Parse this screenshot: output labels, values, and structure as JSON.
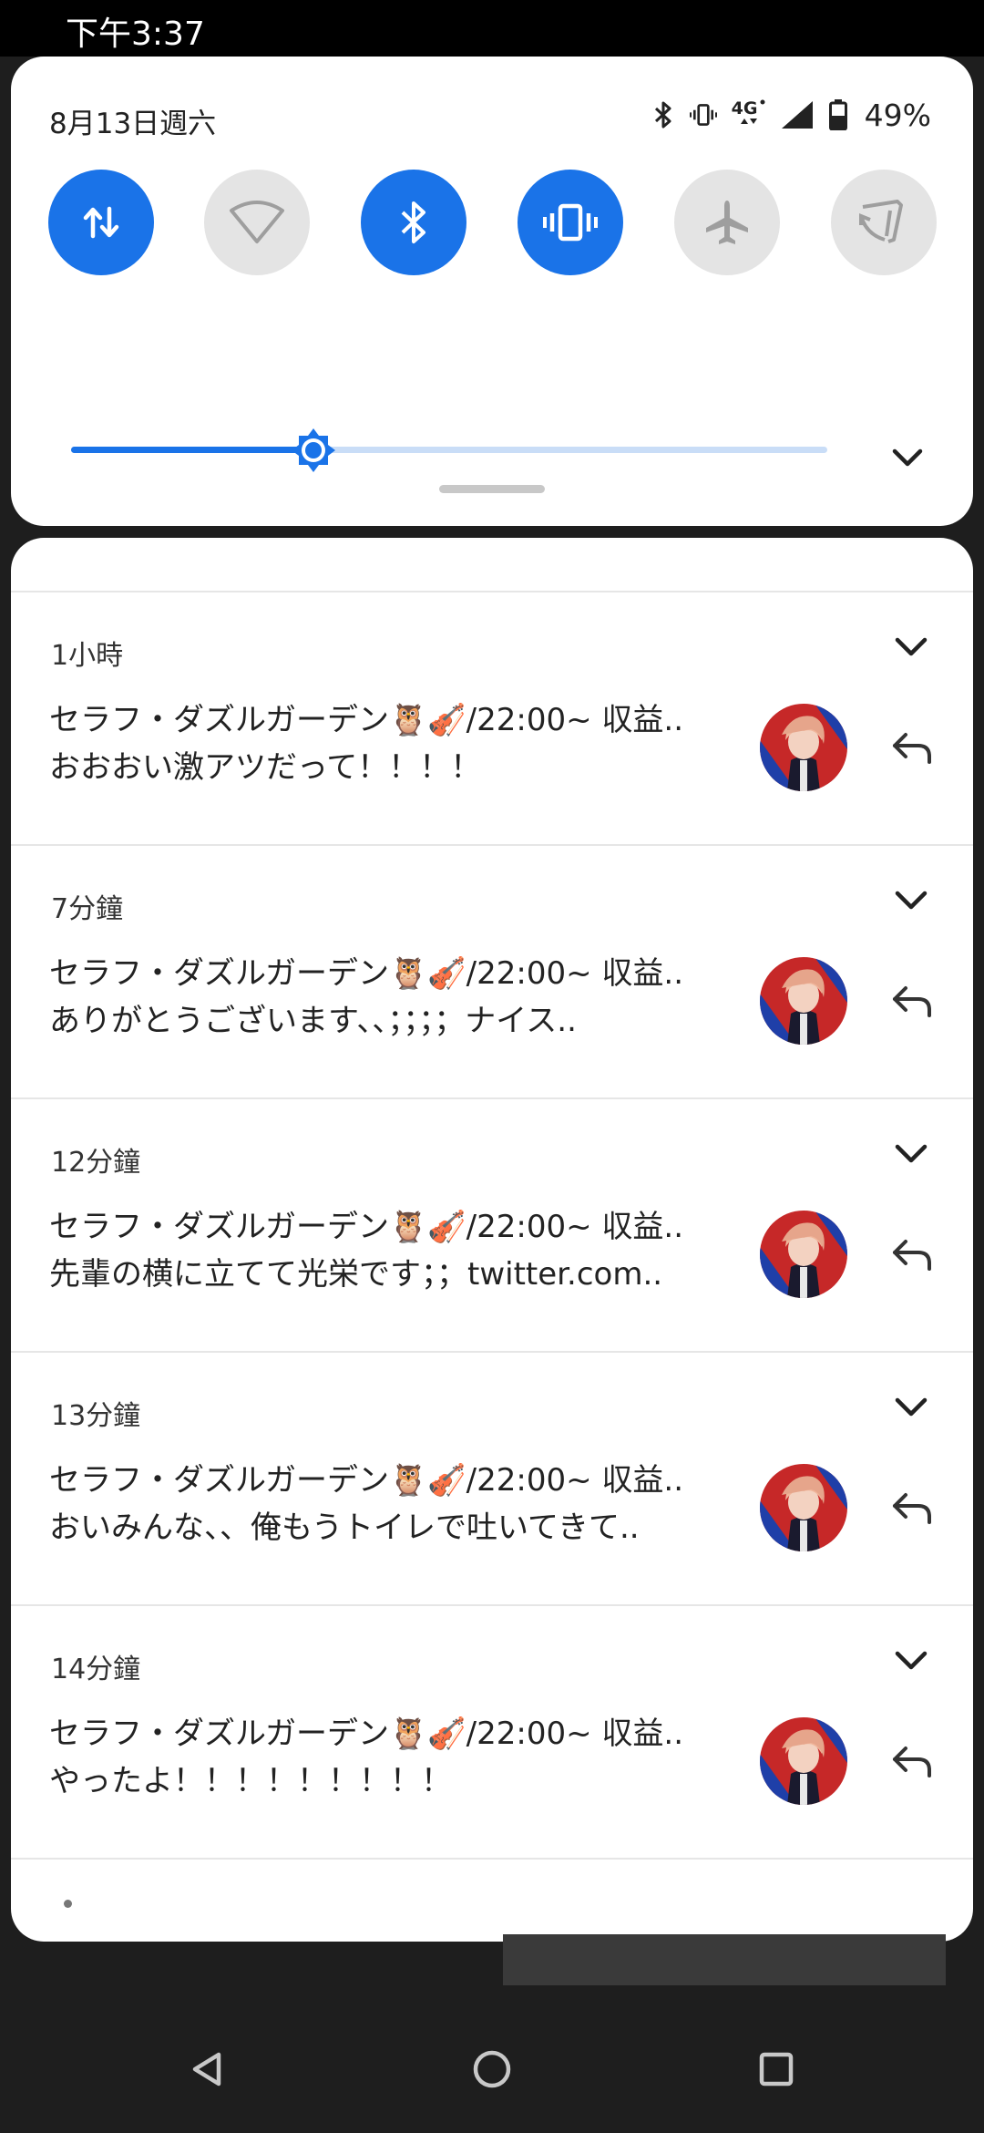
{
  "status_bar": {
    "time": "下午3:37"
  },
  "quick_settings": {
    "date": "8月13日週六",
    "battery_percent": "49%",
    "network_label": "4G",
    "tiles": [
      {
        "name": "mobile-data",
        "on": true
      },
      {
        "name": "wifi",
        "on": false
      },
      {
        "name": "bluetooth",
        "on": true
      },
      {
        "name": "vibrate",
        "on": true
      },
      {
        "name": "airplane-mode",
        "on": false
      },
      {
        "name": "auto-rotate",
        "on": false
      }
    ],
    "brightness_level": 0.32
  },
  "notifications": [
    {
      "time": "1小時",
      "title": "セラフ・ダズルガーデン🦉🎻/22:00~ 収益..",
      "body": "おおおい激アツだって！！！！"
    },
    {
      "time": "7分鐘",
      "title": "セラフ・ダズルガーデン🦉🎻/22:00~ 収益..",
      "body": "ありがとうございます、、；；；；ナイス.."
    },
    {
      "time": "12分鐘",
      "title": "セラフ・ダズルガーデン🦉🎻/22:00~ 収益..",
      "body": "先輩の横に立てて光栄です；；twitter.com.."
    },
    {
      "time": "13分鐘",
      "title": "セラフ・ダズルガーデン🦉🎻/22:00~ 収益..",
      "body": "おいみんな、、俺もうトイレで吐いてきて.."
    },
    {
      "time": "14分鐘",
      "title": "セラフ・ダズルガーデン🦉🎻/22:00~ 収益..",
      "body": "やったよ！！！！！！！！！"
    }
  ],
  "colors": {
    "accent": "#1a73e8",
    "tile_off": "#e4e4e4",
    "avatar_bg": "#c62828"
  }
}
